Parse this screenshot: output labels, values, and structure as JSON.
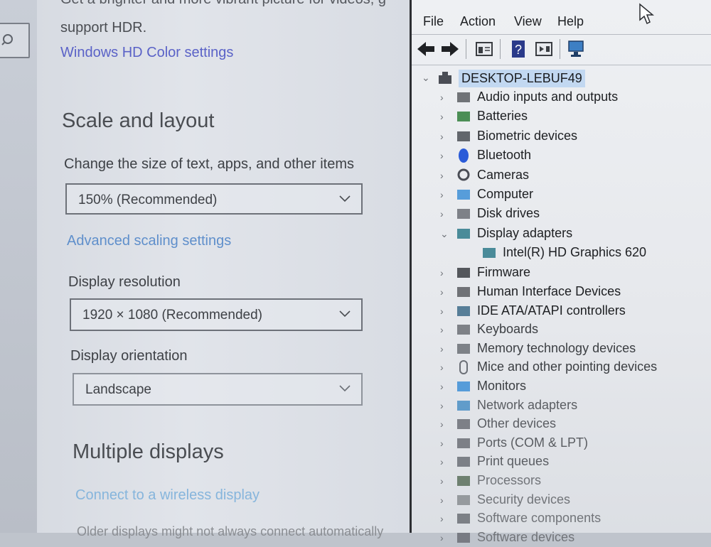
{
  "settings": {
    "clipped_top_text": "Get a brighter and more vibrant picture for videos, g",
    "support_hdr": "support HDR.",
    "hdr_link": "Windows HD Color settings",
    "scale_heading": "Scale and layout",
    "size_label": "Change the size of text, apps, and other items",
    "size_value": "150% (Recommended)",
    "advanced_link": "Advanced scaling settings",
    "resolution_label": "Display resolution",
    "resolution_value": "1920 × 1080 (Recommended)",
    "orientation_label": "Display orientation",
    "orientation_value": "Landscape",
    "multiple_heading": "Multiple displays",
    "wireless_link": "Connect to a wireless display",
    "bottom_clipped": "Older displays might not always connect automatically"
  },
  "device_manager": {
    "menu": [
      "File",
      "Action",
      "View",
      "Help"
    ],
    "root": "DESKTOP-LEBUF49",
    "items": [
      {
        "label": "Audio inputs and outputs",
        "icon": "speaker-icon",
        "expanded": false
      },
      {
        "label": "Batteries",
        "icon": "battery-icon",
        "expanded": false
      },
      {
        "label": "Biometric devices",
        "icon": "fingerprint-icon",
        "expanded": false
      },
      {
        "label": "Bluetooth",
        "icon": "bluetooth-icon",
        "expanded": false
      },
      {
        "label": "Cameras",
        "icon": "camera-icon",
        "expanded": false
      },
      {
        "label": "Computer",
        "icon": "monitor-icon",
        "expanded": false
      },
      {
        "label": "Disk drives",
        "icon": "disk-icon",
        "expanded": false
      },
      {
        "label": "Display adapters",
        "icon": "display-adapter-icon",
        "expanded": true
      },
      {
        "label": "Intel(R) HD Graphics 620",
        "icon": "display-adapter-icon",
        "child": true
      },
      {
        "label": "Firmware",
        "icon": "firmware-icon",
        "expanded": false
      },
      {
        "label": "Human Interface Devices",
        "icon": "hid-icon",
        "expanded": false
      },
      {
        "label": "IDE ATA/ATAPI controllers",
        "icon": "ide-icon",
        "expanded": false
      },
      {
        "label": "Keyboards",
        "icon": "keyboard-icon",
        "expanded": false
      },
      {
        "label": "Memory technology devices",
        "icon": "memory-icon",
        "expanded": false
      },
      {
        "label": "Mice and other pointing devices",
        "icon": "mouse-icon",
        "expanded": false
      },
      {
        "label": "Monitors",
        "icon": "monitor-icon",
        "expanded": false
      },
      {
        "label": "Network adapters",
        "icon": "network-icon",
        "expanded": false
      },
      {
        "label": "Other devices",
        "icon": "other-devices-icon",
        "expanded": false
      },
      {
        "label": "Ports (COM & LPT)",
        "icon": "port-icon",
        "expanded": false
      },
      {
        "label": "Print queues",
        "icon": "printer-icon",
        "expanded": false
      },
      {
        "label": "Processors",
        "icon": "processor-icon",
        "expanded": false
      },
      {
        "label": "Security devices",
        "icon": "security-icon",
        "expanded": false
      },
      {
        "label": "Software components",
        "icon": "software-icon",
        "expanded": false
      },
      {
        "label": "Software devices",
        "icon": "software-icon",
        "expanded": false
      }
    ]
  },
  "colors": {
    "link_blue": "#5a62c7",
    "selection": "#c2d8f1"
  }
}
